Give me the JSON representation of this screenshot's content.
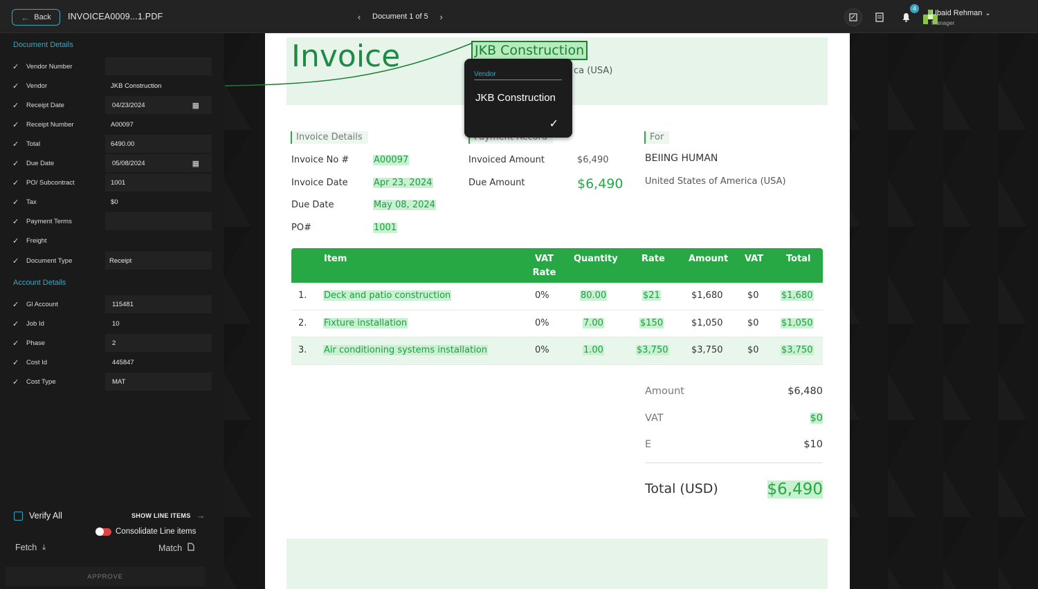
{
  "topbar": {
    "back_label": "Back",
    "filename": "INVOICEA0009...1.PDF",
    "doc_position": "Document 1 of 5",
    "notifications_count": "4",
    "user_name": "Ubaid Rehman",
    "user_role": "Manager",
    "icons": [
      "note-icon",
      "receipt-icon",
      "bell-icon",
      "avatar"
    ]
  },
  "sidebar": {
    "document_details_title": "Document Details",
    "document_fields": [
      {
        "label": "Vendor Number",
        "value": ""
      },
      {
        "label": "Vendor",
        "value": "JKB Construction"
      },
      {
        "label": "Receipt Date",
        "value": "04/23/2024"
      },
      {
        "label": "Receipt Number",
        "value": "A00097"
      },
      {
        "label": "Total",
        "value": "6490.00"
      },
      {
        "label": "Due Date",
        "value": "05/08/2024"
      },
      {
        "label": "PO/ Subcontract",
        "value": "1001"
      },
      {
        "label": "Tax",
        "value": "$0"
      },
      {
        "label": "Payment Terms",
        "value": ""
      },
      {
        "label": "Freight",
        "value": ""
      },
      {
        "label": "Document Type",
        "value": "Receipt"
      }
    ],
    "account_details_title": "Account Details",
    "account_fields": [
      {
        "label": "Gl Account",
        "value": "115481"
      },
      {
        "label": "Job Id",
        "value": "10"
      },
      {
        "label": "Phase",
        "value": "2"
      },
      {
        "label": "Cost Id",
        "value": "445847"
      },
      {
        "label": "Cost Type",
        "value": "MAT"
      }
    ],
    "verify_all": "Verify All",
    "show_line_items": "SHOW LINE ITEMS",
    "consolidate": "Consolidate Line items",
    "fetch": "Fetch",
    "match": "Match",
    "approve": "APPROVE"
  },
  "invoice": {
    "title": "Invoice",
    "vendor_name": "JKB Construction",
    "vendor_country_fragment": "ca (USA)",
    "invoice_details_label": "Invoice Details",
    "payment_record_label": "Payment Record",
    "for_label": "For",
    "invoice_no_label": "Invoice No #",
    "invoice_no": "A00097",
    "invoice_date_label": "Invoice Date",
    "invoice_date": "Apr 23, 2024",
    "due_date_label": "Due Date",
    "due_date": "May 08, 2024",
    "po_label": "PO#",
    "po": "1001",
    "invoiced_amount_label": "Invoiced Amount",
    "invoiced_amount": "$6,490",
    "due_amount_label": "Due Amount",
    "due_amount": "$6,490",
    "customer_name": "BEIING HUMAN",
    "customer_country": "United States of America (USA)",
    "table_headers": {
      "item": "Item",
      "vat_rate_1": "VAT",
      "vat_rate_2": "Rate",
      "quantity": "Quantity",
      "rate": "Rate",
      "amount": "Amount",
      "vat": "VAT",
      "total": "Total"
    },
    "line_items": [
      {
        "num": "1.",
        "item": "Deck and patio construction",
        "vat_rate": "0%",
        "quantity": "80.00",
        "rate": "$21",
        "amount": "$1,680",
        "vat": "$0",
        "total": "$1,680"
      },
      {
        "num": "2.",
        "item": "Fixture installation",
        "vat_rate": "0%",
        "quantity": "7.00",
        "rate": "$150",
        "amount": "$1,050",
        "vat": "$0",
        "total": "$1,050"
      },
      {
        "num": "3.",
        "item": "Air conditioning systems installation",
        "vat_rate": "0%",
        "quantity": "1.00",
        "rate": "$3,750",
        "amount": "$3,750",
        "vat": "$0",
        "total": "$3,750"
      }
    ],
    "summary": {
      "amount_label": "Amount",
      "amount": "$6,480",
      "vat_label": "VAT",
      "vat": "$0",
      "e_label": "E",
      "e": "$10",
      "total_label": "Total (USD)",
      "total": "$6,490"
    }
  },
  "tooltip": {
    "label": "Vendor",
    "value": "JKB Construction"
  },
  "colors": {
    "accent": "#3aa7c0",
    "invoice_green": "#28a745",
    "highlight": "#c8f2cf"
  }
}
